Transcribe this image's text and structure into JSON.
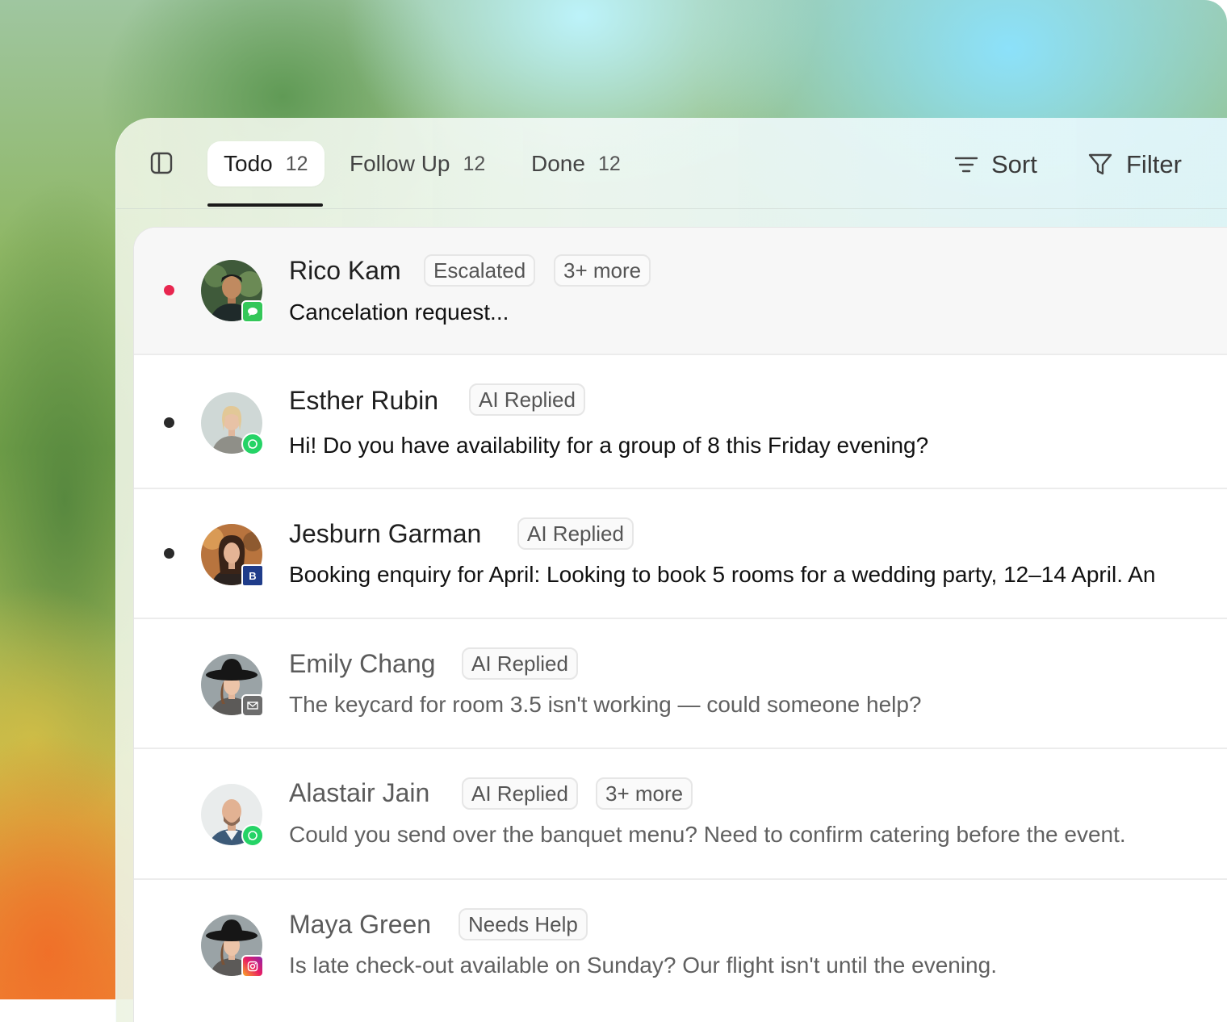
{
  "tabs": [
    {
      "label": "Todo",
      "count": "12"
    },
    {
      "label": "Follow Up",
      "count": "12"
    },
    {
      "label": "Done",
      "count": "12"
    }
  ],
  "toolbar": {
    "sort_label": "Sort",
    "filter_label": "Filter"
  },
  "conversations": [
    {
      "name": "Rico Kam",
      "tags": [
        "Escalated",
        "3+ more"
      ],
      "message": "Cancelation request...",
      "unread": true,
      "dot_color": "#e8264f",
      "channel": "sms-icon"
    },
    {
      "name": "Esther Rubin",
      "tags": [
        "AI Replied"
      ],
      "message": "Hi! Do you have availability for a group of 8 this Friday evening?",
      "unread": true,
      "dot_color": "#2a2a2a",
      "channel": "whatsapp-icon"
    },
    {
      "name": "Jesburn Garman",
      "tags": [
        "AI Replied"
      ],
      "message": "Booking enquiry for April: Looking to book 5 rooms for a wedding party, 12–14 April. An",
      "unread": true,
      "dot_color": "#2a2a2a",
      "channel": "booking-com-icon",
      "channel_letter": "B"
    },
    {
      "name": "Emily Chang",
      "tags": [
        "AI Replied"
      ],
      "message": "The keycard for room 3.5 isn't working — could someone help?",
      "unread": false,
      "channel": "email-icon"
    },
    {
      "name": "Alastair Jain",
      "tags": [
        "AI Replied",
        "3+ more"
      ],
      "message": "Could you send over the banquet menu? Need to confirm catering before the event.",
      "unread": false,
      "channel": "whatsapp-icon"
    },
    {
      "name": "Maya Green",
      "tags": [
        "Needs Help"
      ],
      "message": "Is late check-out available on Sunday? Our flight isn't until the evening.",
      "unread": false,
      "channel": "instagram-icon"
    }
  ],
  "colors": {
    "unread_dot_red": "#e8264f",
    "unread_dot_dark": "#2a2a2a",
    "whatsapp": "#25d366",
    "sms": "#34c759",
    "booking": "#1f3c8a"
  }
}
